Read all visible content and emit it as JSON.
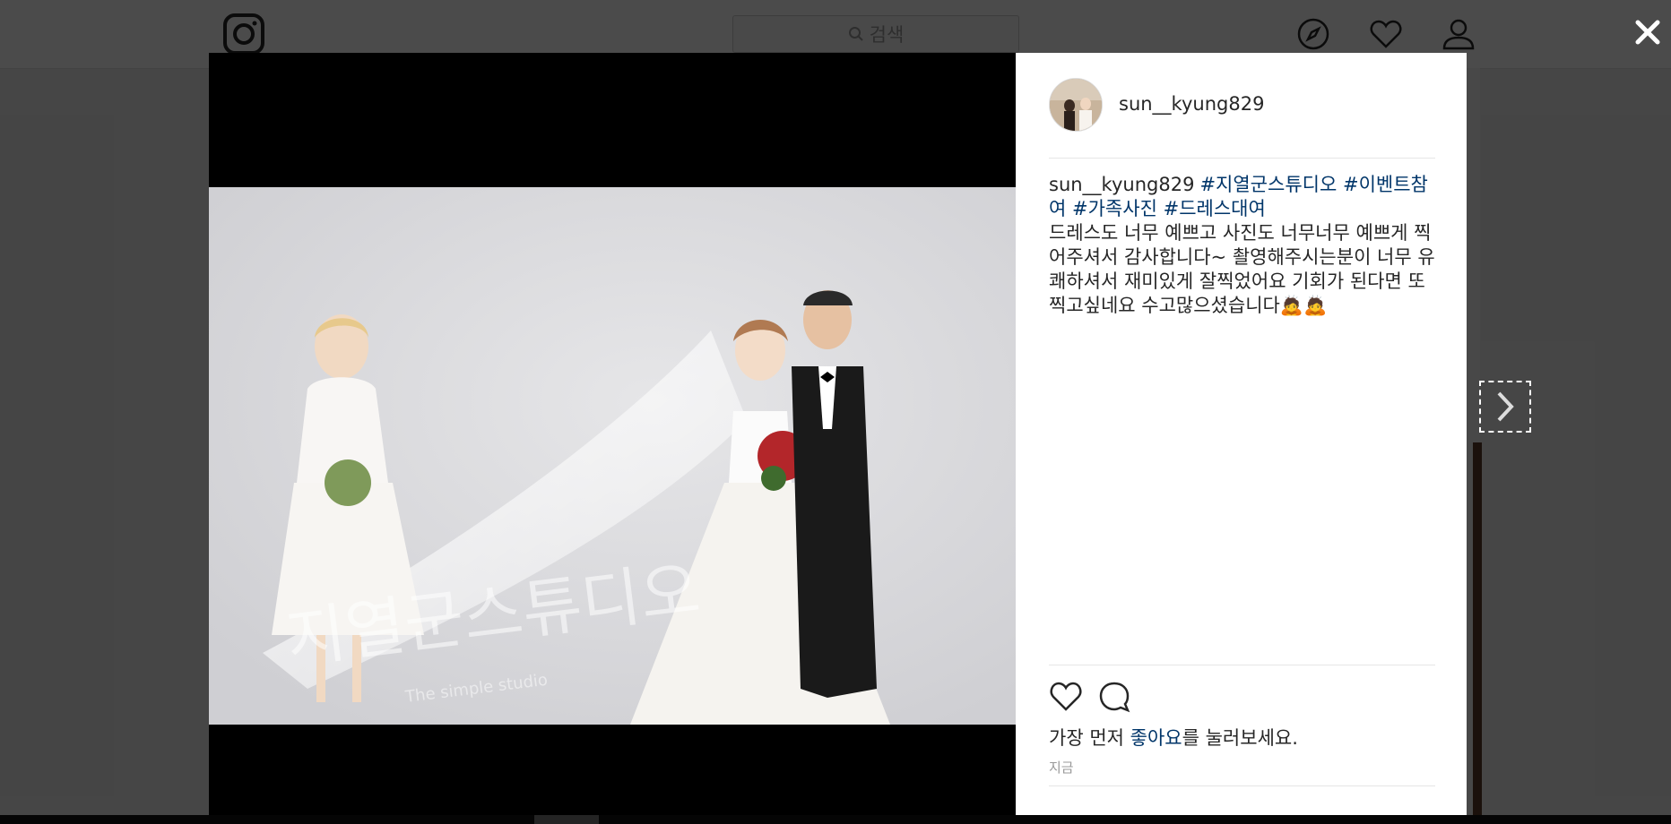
{
  "search": {
    "label": "검색",
    "icon": "search-icon"
  },
  "post": {
    "username": "sun__kyung829",
    "caption": {
      "username": "sun__kyung829",
      "hashtags": [
        "#지열군스튜디오",
        "#이벤트참여",
        "#가족사진",
        "#드레스대여"
      ],
      "text": "드레스도 너무 예쁘고 사진도 너무너무 예쁘게 찍어주셔서 감사합니다~ 촬영해주시는분이 너무 유쾌하셔서 재미있게 잘찍었어요 기회가 된다면 또 찍고싶네요 수고많으셨습니다🙇🙇"
    },
    "likes": {
      "prefix": "가장 먼저 ",
      "link": "좋아요",
      "suffix": "를 눌러보세요."
    },
    "timestamp": "지금",
    "photo_watermark": "지열군스튜디오",
    "photo_watermark_sub": "The simple studio"
  },
  "colors": {
    "overlay": "#000000",
    "link": "#003569",
    "text": "#262626",
    "muted": "#999999"
  },
  "icons": [
    "instagram-logo-icon",
    "compass-icon",
    "heart-icon",
    "user-icon",
    "close-icon",
    "chevron-right-icon",
    "like-heart-icon",
    "comment-icon"
  ]
}
